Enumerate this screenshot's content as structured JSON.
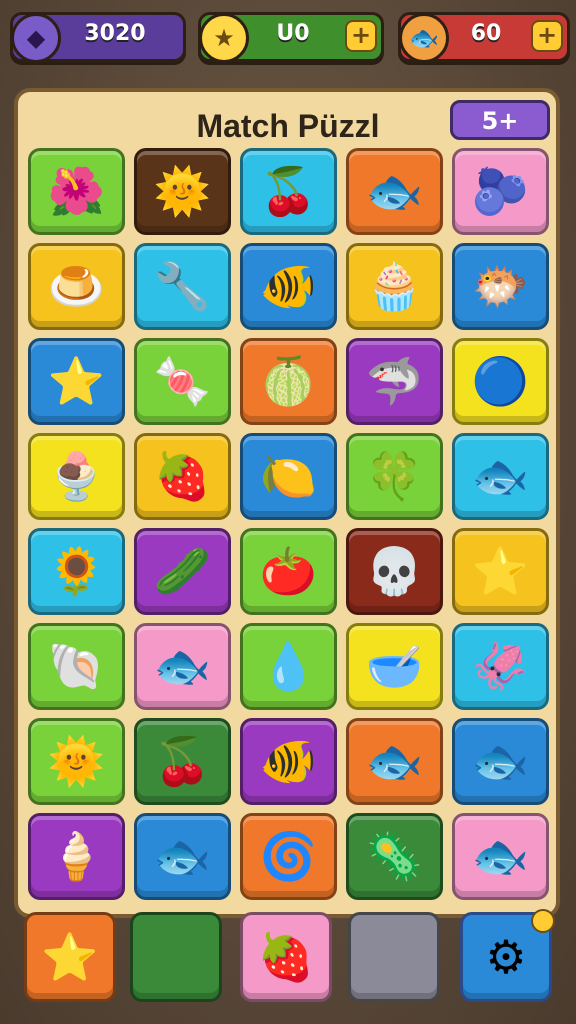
{
  "top_bar": {
    "coins": {
      "value": "3020",
      "icon": "purple-gem-icon"
    },
    "stars": {
      "value": "U0",
      "icon": "star-icon",
      "plus": "+"
    },
    "fish": {
      "value": "60",
      "icon": "fish-icon",
      "plus": "+"
    }
  },
  "board": {
    "title": "Match Püzzl",
    "moves_badge": "5+"
  },
  "tiles": [
    {
      "bg": "#7ad23a",
      "icon": "🌺",
      "name": "purple-flower"
    },
    {
      "bg": "#5a3418",
      "icon": "🌞",
      "name": "sun"
    },
    {
      "bg": "#2fc0e8",
      "icon": "🍒",
      "name": "cherry"
    },
    {
      "bg": "#f0782a",
      "icon": "🐟",
      "name": "orange-fish"
    },
    {
      "bg": "#f59ac8",
      "icon": "🫐",
      "name": "purple-leaf"
    },
    {
      "bg": "#f5c21e",
      "icon": "🍮",
      "name": "pudding"
    },
    {
      "bg": "#2fc0e8",
      "icon": "🔧",
      "name": "tool"
    },
    {
      "bg": "#2a8ad8",
      "icon": "🐠",
      "name": "goldfish"
    },
    {
      "bg": "#f5c21e",
      "icon": "🧁",
      "name": "cupcake"
    },
    {
      "bg": "#2a8ad8",
      "icon": "🐡",
      "name": "green-fish"
    },
    {
      "bg": "#2a8ad8",
      "icon": "⭐",
      "name": "pink-star"
    },
    {
      "bg": "#7ad23a",
      "icon": "🍬",
      "name": "candy"
    },
    {
      "bg": "#f0782a",
      "icon": "🍈",
      "name": "melon"
    },
    {
      "bg": "#9a3ac0",
      "icon": "🦈",
      "name": "blue-fish"
    },
    {
      "bg": "#f5e21e",
      "icon": "🔵",
      "name": "blue-bubble"
    },
    {
      "bg": "#f5e21e",
      "icon": "🍨",
      "name": "bowl"
    },
    {
      "bg": "#f5c21e",
      "icon": "🍓",
      "name": "strawberry"
    },
    {
      "bg": "#2a8ad8",
      "icon": "🍋",
      "name": "lemon-stick"
    },
    {
      "bg": "#7ad23a",
      "icon": "🍀",
      "name": "clover"
    },
    {
      "bg": "#2fc0e8",
      "icon": "🐟",
      "name": "teal-fish"
    },
    {
      "bg": "#2fc0e8",
      "icon": "🌻",
      "name": "sunflower"
    },
    {
      "bg": "#9a3ac0",
      "icon": "🥒",
      "name": "green-pod"
    },
    {
      "bg": "#7ad23a",
      "icon": "🍅",
      "name": "tomato"
    },
    {
      "bg": "#8a2a1a",
      "icon": "💀",
      "name": "skull"
    },
    {
      "bg": "#f5c21e",
      "icon": "⭐",
      "name": "purple-star"
    },
    {
      "bg": "#7ad23a",
      "icon": "🐚",
      "name": "shell"
    },
    {
      "bg": "#f59ac8",
      "icon": "🐟",
      "name": "blue-fish-2"
    },
    {
      "bg": "#7ad23a",
      "icon": "💧",
      "name": "blue-drop"
    },
    {
      "bg": "#f5e21e",
      "icon": "🥣",
      "name": "blue-bowl"
    },
    {
      "bg": "#2fc0e8",
      "icon": "🦑",
      "name": "blue-squid"
    },
    {
      "bg": "#7ad23a",
      "icon": "🌞",
      "name": "sun-2"
    },
    {
      "bg": "#3a8a3a",
      "icon": "🍒",
      "name": "red-cherry"
    },
    {
      "bg": "#9a3ac0",
      "icon": "🐠",
      "name": "striped-fish"
    },
    {
      "bg": "#f0782a",
      "icon": "🐟",
      "name": "orange-fish-2"
    },
    {
      "bg": "#2a8ad8",
      "icon": "🐟",
      "name": "orange-fish-3"
    },
    {
      "bg": "#9a3ac0",
      "icon": "🍦",
      "name": "cone-shell"
    },
    {
      "bg": "#2a8ad8",
      "icon": "🐟",
      "name": "green-fish-2"
    },
    {
      "bg": "#f0782a",
      "icon": "🌀",
      "name": "yellow-swirl"
    },
    {
      "bg": "#3a8a3a",
      "icon": "🦠",
      "name": "pink-blob"
    },
    {
      "bg": "#f59ac8",
      "icon": "🐟",
      "name": "blue-fish-3"
    }
  ],
  "bottom_slots": [
    {
      "bg": "#f0782a",
      "icon": "⭐",
      "name": "star-slot"
    },
    {
      "bg": "#3a8a3a",
      "icon": "",
      "name": "empty-green-slot"
    },
    {
      "bg": "#f59ac8",
      "icon": "🍓",
      "name": "berry-slot"
    },
    {
      "bg": "#8a8a98",
      "icon": "",
      "name": "empty-gray-slot"
    },
    {
      "bg": "#2a8ad8",
      "icon": "⚙",
      "name": "settings-slot"
    }
  ]
}
